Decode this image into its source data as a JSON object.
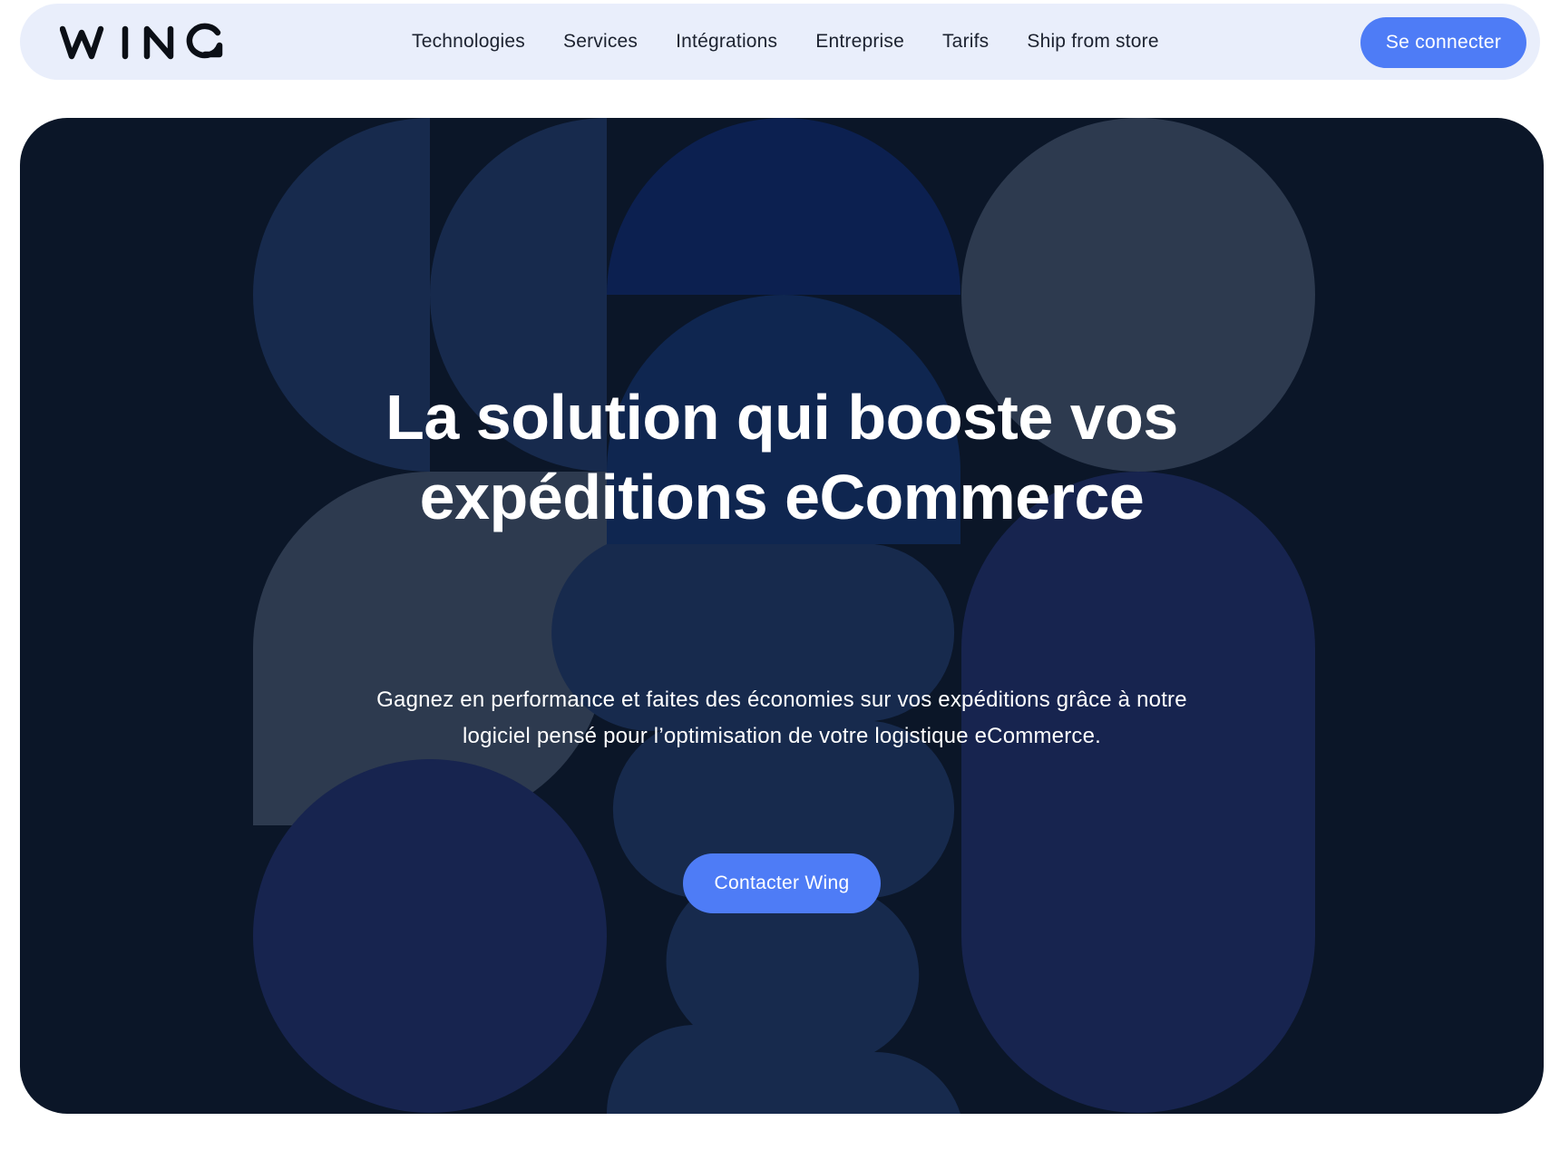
{
  "header": {
    "logo_text": "WING",
    "nav_items": [
      {
        "label": "Technologies"
      },
      {
        "label": "Services"
      },
      {
        "label": "Intégrations"
      },
      {
        "label": "Entreprise"
      },
      {
        "label": "Tarifs"
      },
      {
        "label": "Ship from store"
      }
    ],
    "login_label": "Se connecter"
  },
  "hero": {
    "title_line_1": "La solution qui booste vos",
    "title_line_2": "expéditions eCommerce",
    "subtitle_line_1": "Gagnez en performance et faites des économies sur vos expéditions grâce à notre",
    "subtitle_line_2": "logiciel pensé pour l’optimisation de votre logistique eCommerce.",
    "cta_label": "Contacter Wing"
  },
  "colors": {
    "accent": "#4e7cf6",
    "navbar_bg": "#e9eefb",
    "hero_bg": "#0b1628",
    "shape_navy": "#172a4d",
    "shape_slate": "#2d3a4f",
    "shape_indigo": "#17244f",
    "shape_blue": "#0c2050"
  }
}
